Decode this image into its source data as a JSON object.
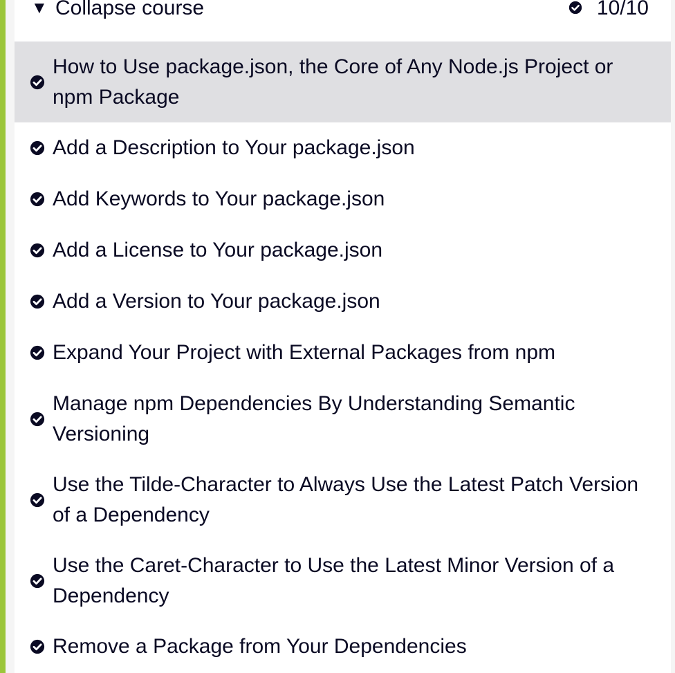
{
  "course": {
    "toggle_label": "Collapse course",
    "caret_icon": "caret-down-icon",
    "progress": "10/10",
    "accent_color": "#9bc63a"
  },
  "lessons": [
    {
      "title": "How to Use package.json, the Core of Any Node.js Project or npm Package",
      "completed": true,
      "active": true
    },
    {
      "title": "Add a Description to Your package.json",
      "completed": true,
      "active": false
    },
    {
      "title": "Add Keywords to Your package.json",
      "completed": true,
      "active": false
    },
    {
      "title": "Add a License to Your package.json",
      "completed": true,
      "active": false
    },
    {
      "title": "Add a Version to Your package.json",
      "completed": true,
      "active": false
    },
    {
      "title": "Expand Your Project with External Packages from npm",
      "completed": true,
      "active": false
    },
    {
      "title": "Manage npm Dependencies By Understanding Semantic Versioning",
      "completed": true,
      "active": false
    },
    {
      "title": "Use the Tilde-Character to Always Use the Latest Patch Version of a Dependency",
      "completed": true,
      "active": false
    },
    {
      "title": "Use the Caret-Character to Use the Latest Minor Version of a Dependency",
      "completed": true,
      "active": false
    },
    {
      "title": "Remove a Package from Your Dependencies",
      "completed": true,
      "active": false
    }
  ]
}
